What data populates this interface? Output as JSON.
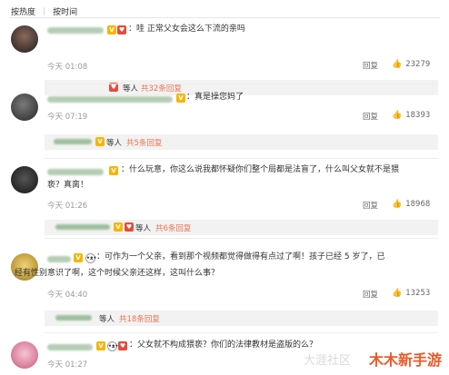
{
  "tabs": {
    "hot": "按热度",
    "time": "按时间"
  },
  "comments": [
    {
      "text": "：哇 正常父女会这么下流的亲吗",
      "time": "今天 01:08",
      "reply": "回复",
      "likes": "23279",
      "sub": {
        "etc": "等人",
        "more": "共32条回复"
      }
    },
    {
      "text": "：真是操您妈了",
      "time": "今天 07:19",
      "reply": "回复",
      "likes": "18393",
      "sub": {
        "etc": "等人",
        "more": "共5条回复"
      }
    },
    {
      "text1": "：什么玩意，你这么说我都怀疑你们整个局都是法盲了，什么叫父女就不是猥",
      "text2": "亵？真脔！",
      "time": "今天 01:26",
      "reply": "回复",
      "likes": "18968",
      "sub": {
        "etc": "等人",
        "more": "共6条回复"
      }
    },
    {
      "text1": "：可作为一个父亲，看到那个视频都觉得做得有点过了啊！孩子已经 5 岁了，已",
      "text2": "经有性别意识了啊，这个时候父亲还这样，这叫什么事？",
      "time": "今天 04:40",
      "reply": "回复",
      "likes": "13253",
      "sub": {
        "etc": "等人",
        "more": "共18条回复"
      }
    },
    {
      "text": "：父女就不构成猥亵？你们的法律教材是盗版的么？",
      "time": "今天 01:27"
    }
  ],
  "watermark": {
    "main": "木木新手游",
    "faint": "大涯社区"
  },
  "colors": {
    "link": "#eb7350",
    "badge_gold": "#f7b500",
    "badge_red": "#e84a3a"
  }
}
